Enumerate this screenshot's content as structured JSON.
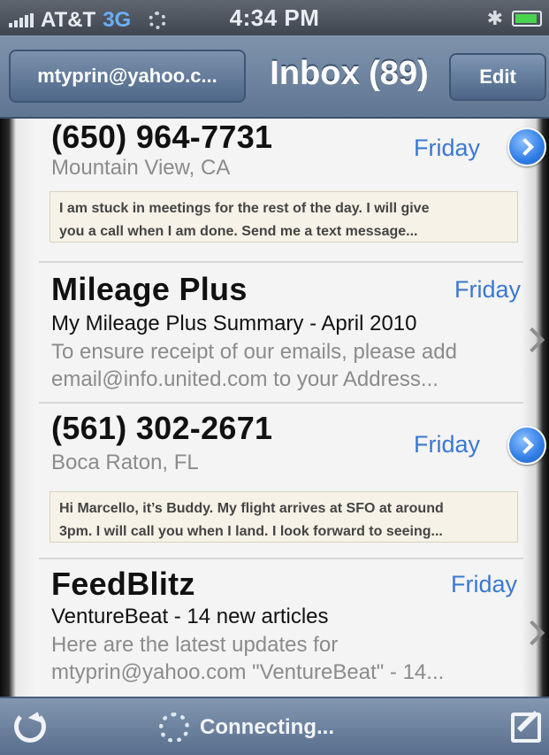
{
  "status": {
    "carrier": "AT&T",
    "network": "3G",
    "time": "4:34 PM",
    "icons": [
      "signal-icon",
      "activity-spinner-icon",
      "bluetooth-icon",
      "battery-charging-icon"
    ]
  },
  "nav": {
    "back_label": "mtyprin@yahoo.c...",
    "title": "Inbox (89)",
    "edit_label": "Edit"
  },
  "messages": [
    {
      "sender": "(650) 964-7731",
      "location": "Mountain View, CA",
      "date": "Friday",
      "snippet_lines": [
        "I am stuck in meetings for the rest of the day.  I will give",
        "you a call when I am done.  Send me a text message..."
      ]
    },
    {
      "sender": "Mileage Plus",
      "date": "Friday",
      "subject": "My Mileage Plus Summary - April 2010",
      "preview_lines": [
        "To ensure receipt of our emails, please add",
        "email@info.united.com to your Address..."
      ]
    },
    {
      "sender": "(561) 302-2671",
      "location": "Boca Raton, FL",
      "date": "Friday",
      "snippet_lines": [
        "Hi Marcello, it’s Buddy.  My flight arrives at SFO at around",
        "3pm.  I will call you when I land. I look forward to seeing..."
      ]
    },
    {
      "sender": "FeedBlitz",
      "date": "Friday",
      "subject": "VentureBeat - 14 new articles",
      "preview_lines": [
        "Here are the latest updates for",
        "mtyprin@yahoo.com \"VentureBeat\" - 14..."
      ]
    }
  ],
  "toolbar": {
    "status_text": "Connecting...",
    "icons": [
      "refresh-icon",
      "connecting-spinner-icon",
      "compose-icon"
    ]
  }
}
